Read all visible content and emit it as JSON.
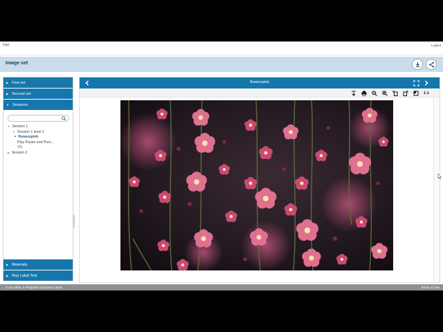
{
  "header": {
    "logo_alt": "logo",
    "logout": "Logout"
  },
  "titlebar": {
    "title": "Image set",
    "icons": [
      "download-icon",
      "share-icon"
    ]
  },
  "sidebar": {
    "sections": [
      {
        "label": "First set",
        "expanded": false
      },
      {
        "label": "Second set",
        "expanded": false
      },
      {
        "label": "Sessions",
        "expanded": true
      },
      {
        "label": "Materials",
        "expanded": false
      },
      {
        "label": "Rep Label Test",
        "expanded": false
      }
    ],
    "search_placeholder": "",
    "tree": {
      "session1": "Session 1",
      "session1_level2": "Session 1 level 2",
      "selected": "flowerspink",
      "play_line1": "Play Pause and Pres...",
      "play_line2": "VS",
      "session2": "Session 2"
    }
  },
  "viewer": {
    "title": "flowerspink",
    "toolbar": [
      "collapse-icon",
      "print-icon",
      "zoom-out-icon",
      "zoom-in-icon",
      "rotate-left-icon",
      "rotate-right-icon",
      "fit-icon",
      "1:1"
    ],
    "actual_size_label": "1:1"
  },
  "footer": {
    "copyright": "© Ex Libris, a ProQuest Company, 2018",
    "terms": "Terms of Use"
  },
  "colors": {
    "primary": "#1777ad",
    "titlebar": "#c8dde9",
    "footer": "#8c9096"
  }
}
